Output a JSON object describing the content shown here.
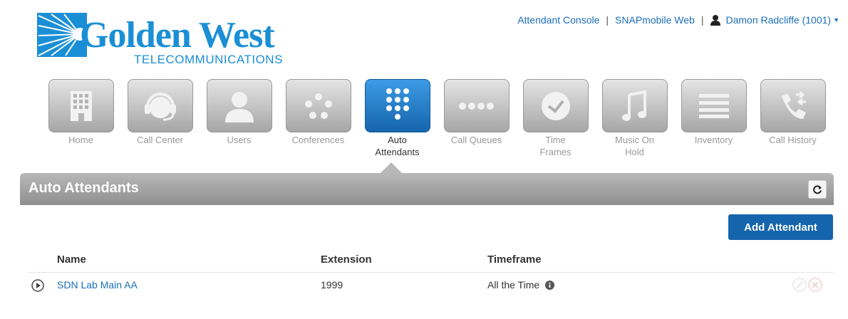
{
  "brand": {
    "name": "Golden West",
    "subtitle": "TELECOMMUNICATIONS",
    "color": "#1a8fd6"
  },
  "topnav": {
    "attendant_console": "Attendant Console",
    "sep1": "|",
    "snapmobile": "SNAPmobile Web",
    "sep2": "|",
    "user": "Damon Radcliffe (1001)"
  },
  "nav": {
    "items": [
      {
        "label": "Home",
        "icon": "building-icon"
      },
      {
        "label": "Call Center",
        "icon": "headset-icon"
      },
      {
        "label": "Users",
        "icon": "user-icon"
      },
      {
        "label": "Conferences",
        "icon": "dots-circle-icon"
      },
      {
        "label": "Auto Attendants",
        "icon": "keypad-icon",
        "active": true
      },
      {
        "label": "Call Queues",
        "icon": "dots-row-icon"
      },
      {
        "label": "Time Frames",
        "icon": "clock-icon"
      },
      {
        "label": "Music On Hold",
        "icon": "music-note-icon"
      },
      {
        "label": "Inventory",
        "icon": "list-icon"
      },
      {
        "label": "Call History",
        "icon": "phone-arrows-icon"
      }
    ]
  },
  "section": {
    "title": "Auto Attendants"
  },
  "actions": {
    "add_attendant": "Add Attendant"
  },
  "table": {
    "columns": [
      "Name",
      "Extension",
      "Timeframe"
    ],
    "rows": [
      {
        "name": "SDN Lab Main AA",
        "extension": "1999",
        "timeframe": "All the Time"
      }
    ]
  },
  "colors": {
    "accent": "#1565ac",
    "link": "#1a6fb8"
  }
}
